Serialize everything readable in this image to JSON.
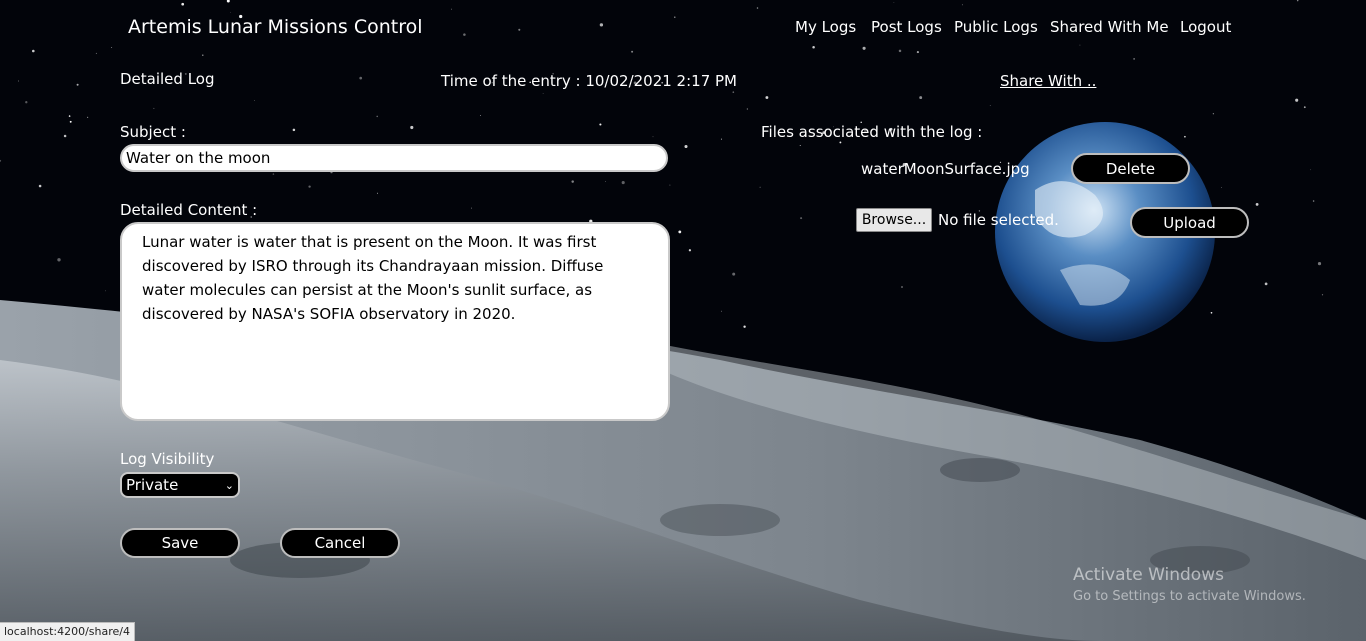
{
  "header": {
    "app_title": "Artemis Lunar Missions Control",
    "nav": [
      "My Logs",
      "Post Logs",
      "Public Logs",
      "Shared With Me",
      "Logout"
    ]
  },
  "log": {
    "heading": "Detailed Log",
    "entry_time": "Time of the entry : 10/02/2021 2:17 PM",
    "share_link": "Share With ..",
    "subject_label": "Subject :",
    "subject_value": "Water on the moon",
    "content_label": "Detailed Content :",
    "content_value": "Lunar water is water that is present on the Moon. It was first discovered by ISRO through its Chandrayaan mission. Diffuse water molecules can persist at the Moon's sunlit surface, as discovered by NASA's SOFIA observatory in 2020.",
    "visibility_label": "Log Visibility",
    "visibility_value": "Private",
    "save_label": "Save",
    "cancel_label": "Cancel"
  },
  "files": {
    "label": "Files associated with the log :",
    "items": [
      {
        "name": "waterMoonSurface.jpg",
        "delete_label": "Delete"
      }
    ],
    "browse_label": "Browse...",
    "no_file_text": "No file selected.",
    "upload_label": "Upload"
  },
  "watermark": {
    "title": "Activate Windows",
    "subtitle": "Go to Settings to activate Windows."
  },
  "status_bar": {
    "url": "localhost:4200/share/4"
  }
}
